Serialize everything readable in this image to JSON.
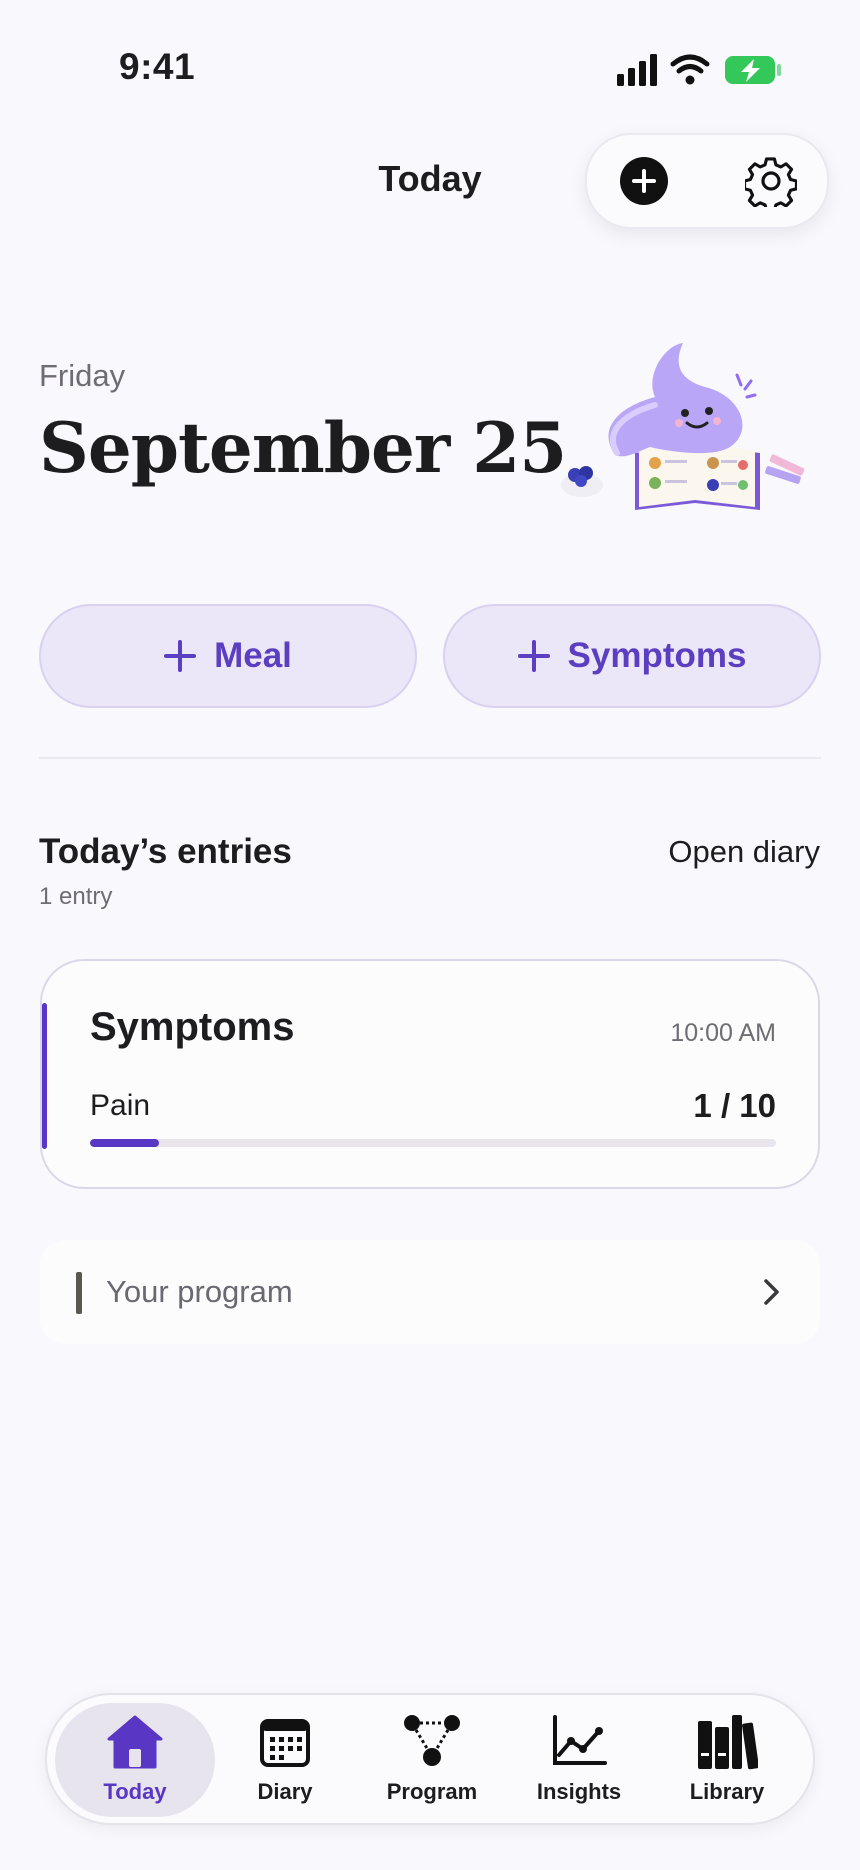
{
  "status_bar": {
    "time": "9:41"
  },
  "header": {
    "title": "Today"
  },
  "date": {
    "weekday": "Friday",
    "date": "September 25"
  },
  "actions": {
    "meal_label": "Meal",
    "symptoms_label": "Symptoms"
  },
  "entries": {
    "title": "Today’s entries",
    "count": "1 entry",
    "open_diary": "Open diary",
    "items": [
      {
        "type": "Symptoms",
        "time": "10:00 AM",
        "metric": "Pain",
        "value": "1 / 10",
        "level": 0.1
      }
    ]
  },
  "program": {
    "label": "Your program"
  },
  "tabs": [
    {
      "label": "Today",
      "icon": "house-icon",
      "active": true
    },
    {
      "label": "Diary",
      "icon": "calendar-icon",
      "active": false
    },
    {
      "label": "Program",
      "icon": "nodes-icon",
      "active": false
    },
    {
      "label": "Insights",
      "icon": "chart-line-icon",
      "active": false
    },
    {
      "label": "Library",
      "icon": "books-icon",
      "active": false
    }
  ],
  "colors": {
    "accent": "#5a36c4",
    "button_bg": "#ebe7f8",
    "battery": "#34c759"
  }
}
